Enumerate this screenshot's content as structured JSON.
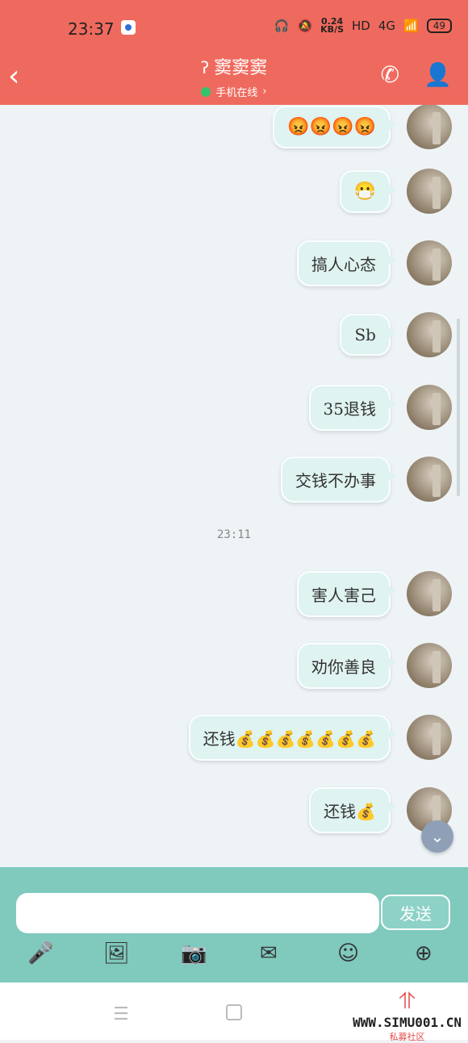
{
  "status_bar": {
    "time": "23:37",
    "net_speed": "0.24",
    "net_unit": "KB/S",
    "hd": "HD",
    "network": "4G",
    "battery": "49"
  },
  "header": {
    "title": "窦窦窦",
    "status": "手机在线",
    "status_chevron": "›"
  },
  "messages": [
    {
      "text": "😡😡😡😡"
    },
    {
      "text": "😷"
    },
    {
      "text": "搞人心态"
    },
    {
      "text": "Sb"
    },
    {
      "text": "35退钱"
    },
    {
      "text": "交钱不办事"
    },
    {
      "text": "害人害己"
    },
    {
      "text": "劝你善良"
    },
    {
      "text": "还钱💰💰💰💰💰💰💰"
    },
    {
      "text": "还钱💰"
    }
  ],
  "timestamp": "23:11",
  "input": {
    "placeholder": "",
    "send_label": "发送"
  },
  "toolbar_icons": [
    "microphone-icon",
    "image-icon",
    "camera-icon",
    "hongbao-icon",
    "emoji-icon",
    "plus-icon"
  ],
  "watermark": {
    "url": "WWW.SIMU001.CN",
    "subtitle": "私募社区"
  },
  "colors": {
    "header": "#ef6a5e",
    "bubble": "#dff3f1",
    "input_bar": "#7fc9bd"
  }
}
